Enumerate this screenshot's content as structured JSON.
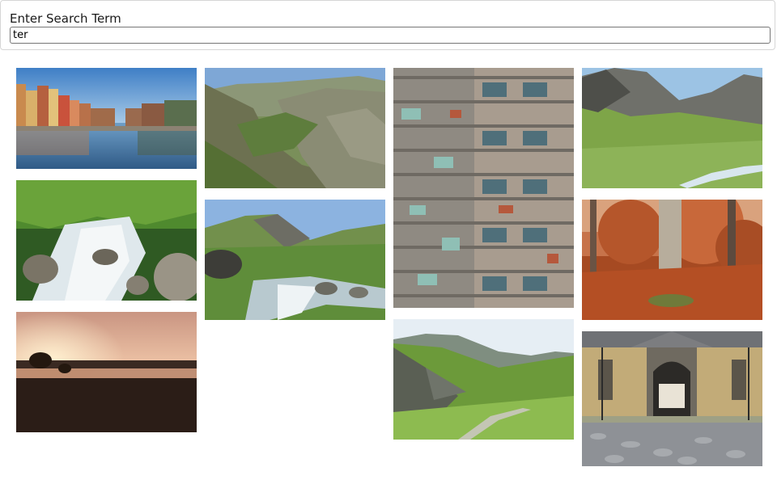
{
  "search": {
    "label": "Enter Search Term",
    "value": "ter"
  },
  "gallery": {
    "items": [
      {
        "subject": "city-canal"
      },
      {
        "subject": "mountain-valley"
      },
      {
        "subject": "apartment-building"
      },
      {
        "subject": "green-valley-river"
      },
      {
        "subject": "forest-stream"
      },
      {
        "subject": "mountain-stream"
      },
      {
        "subject": "autumn-forest"
      },
      {
        "subject": "misty-sunset-field"
      },
      {
        "subject": "mountain-meadow"
      },
      {
        "subject": "palace-gate"
      }
    ]
  }
}
